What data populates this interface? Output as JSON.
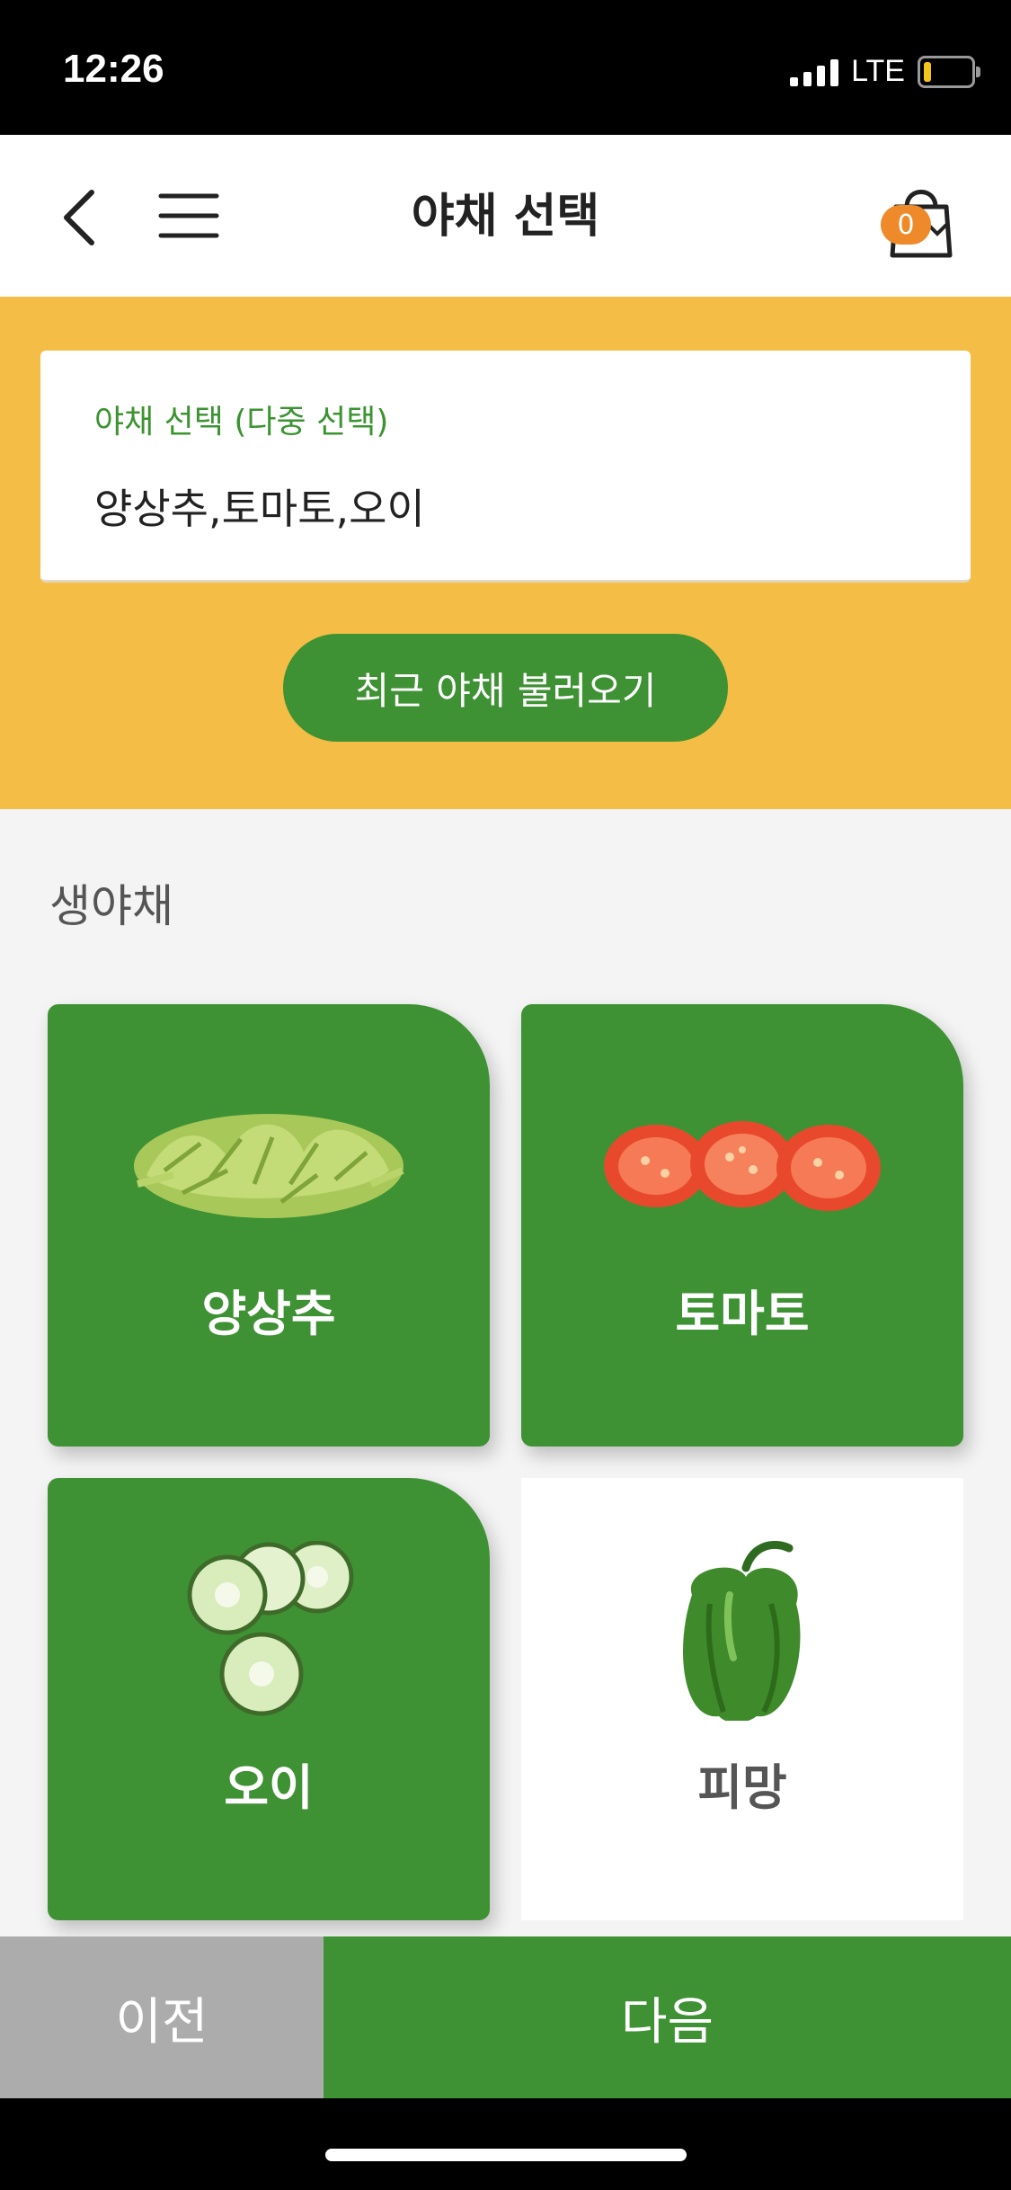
{
  "status_bar": {
    "time": "12:26",
    "network": "LTE",
    "icons": [
      "signal-icon",
      "battery-icon"
    ]
  },
  "nav": {
    "title": "야채 선택",
    "cart_count": "0",
    "icons": [
      "back-arrow-icon",
      "hamburger-menu-icon",
      "shopping-bag-icon"
    ]
  },
  "selection": {
    "label": "야채 선택 (다중 선택)",
    "value": "양상추,토마토,오이",
    "recent_button": "최근 야채 불러오기"
  },
  "section": {
    "title": "생야채"
  },
  "vegetables": [
    {
      "name": "양상추",
      "selected": true,
      "image": "lettuce-image"
    },
    {
      "name": "토마토",
      "selected": true,
      "image": "tomato-image"
    },
    {
      "name": "오이",
      "selected": true,
      "image": "cucumber-image"
    },
    {
      "name": "피망",
      "selected": false,
      "image": "green-pepper-image"
    }
  ],
  "footer": {
    "prev": "이전",
    "next": "다음"
  },
  "colors": {
    "primary_green": "#3e9234",
    "accent_yellow": "#f4bd45",
    "badge_orange": "#ee8a2a",
    "disabled_gray": "#acacac"
  }
}
